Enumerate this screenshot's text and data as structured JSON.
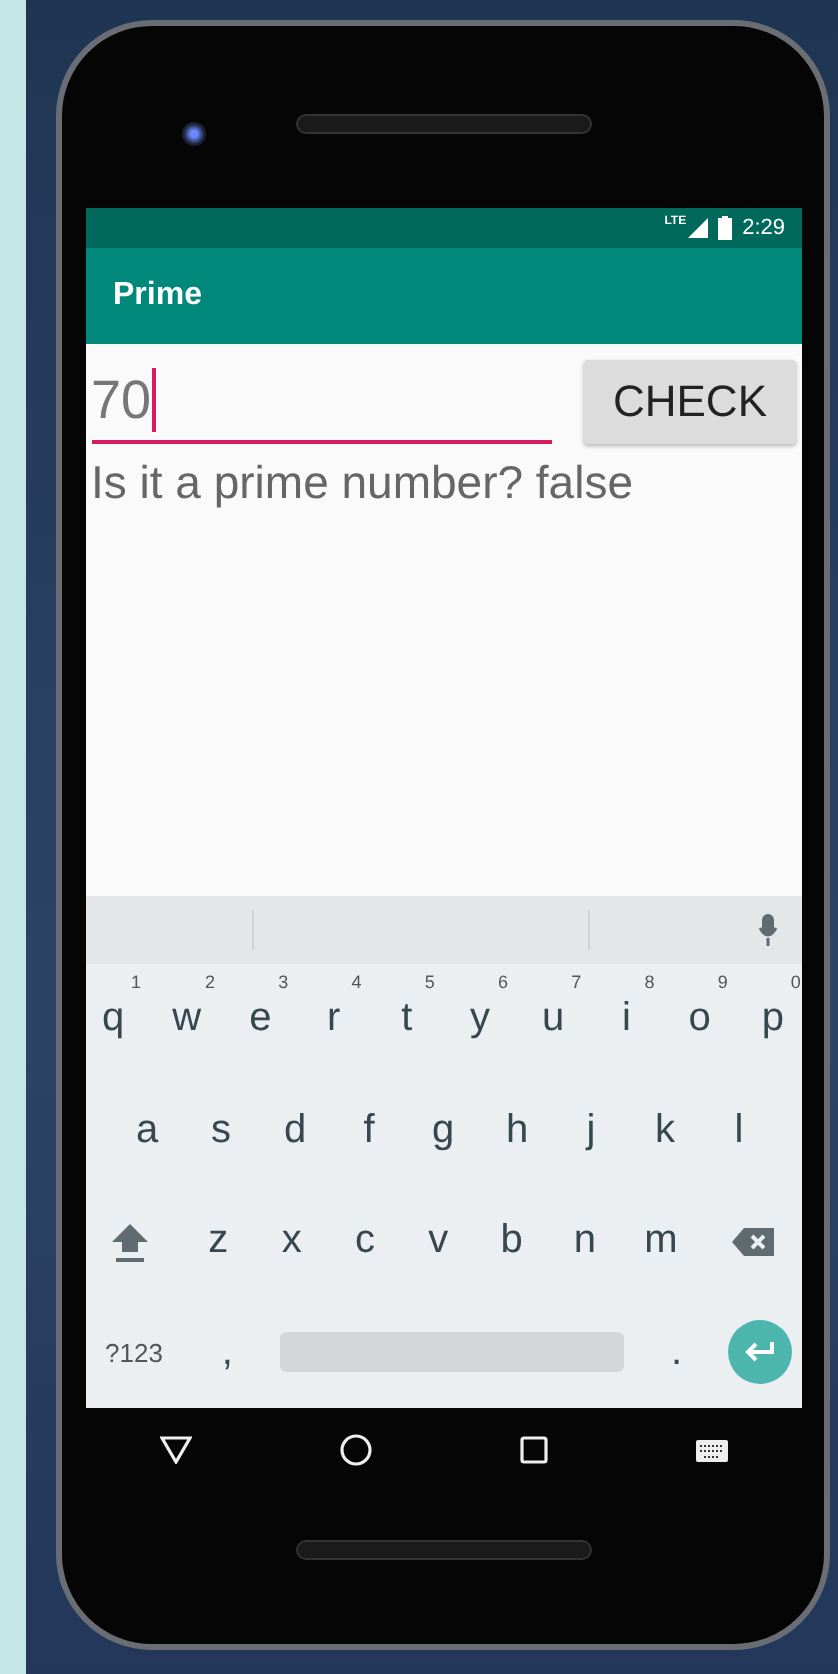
{
  "status_bar": {
    "network": "LTE",
    "time": "2:29"
  },
  "app_bar": {
    "title": "Prime"
  },
  "input": {
    "value": "70",
    "focused": true
  },
  "check_button": {
    "label": "CHECK"
  },
  "result": "Is it a prime number? false",
  "keyboard": {
    "rows": [
      [
        {
          "kind": "letter",
          "label": "q",
          "hint": "1"
        },
        {
          "kind": "letter",
          "label": "w",
          "hint": "2"
        },
        {
          "kind": "letter",
          "label": "e",
          "hint": "3"
        },
        {
          "kind": "letter",
          "label": "r",
          "hint": "4"
        },
        {
          "kind": "letter",
          "label": "t",
          "hint": "5"
        },
        {
          "kind": "letter",
          "label": "y",
          "hint": "6"
        },
        {
          "kind": "letter",
          "label": "u",
          "hint": "7"
        },
        {
          "kind": "letter",
          "label": "i",
          "hint": "8"
        },
        {
          "kind": "letter",
          "label": "o",
          "hint": "9"
        },
        {
          "kind": "letter",
          "label": "p",
          "hint": "0"
        }
      ],
      [
        {
          "kind": "letter",
          "label": "a"
        },
        {
          "kind": "letter",
          "label": "s"
        },
        {
          "kind": "letter",
          "label": "d"
        },
        {
          "kind": "letter",
          "label": "f"
        },
        {
          "kind": "letter",
          "label": "g"
        },
        {
          "kind": "letter",
          "label": "h"
        },
        {
          "kind": "letter",
          "label": "j"
        },
        {
          "kind": "letter",
          "label": "k"
        },
        {
          "kind": "letter",
          "label": "l"
        }
      ],
      [
        {
          "kind": "shift"
        },
        {
          "kind": "letter",
          "label": "z"
        },
        {
          "kind": "letter",
          "label": "x"
        },
        {
          "kind": "letter",
          "label": "c"
        },
        {
          "kind": "letter",
          "label": "v"
        },
        {
          "kind": "letter",
          "label": "b"
        },
        {
          "kind": "letter",
          "label": "n"
        },
        {
          "kind": "letter",
          "label": "m"
        },
        {
          "kind": "backspace"
        }
      ],
      [
        {
          "kind": "symbols",
          "label": "?123"
        },
        {
          "kind": "letter",
          "label": ","
        },
        {
          "kind": "space"
        },
        {
          "kind": "letter",
          "label": "."
        },
        {
          "kind": "enter"
        }
      ]
    ]
  }
}
